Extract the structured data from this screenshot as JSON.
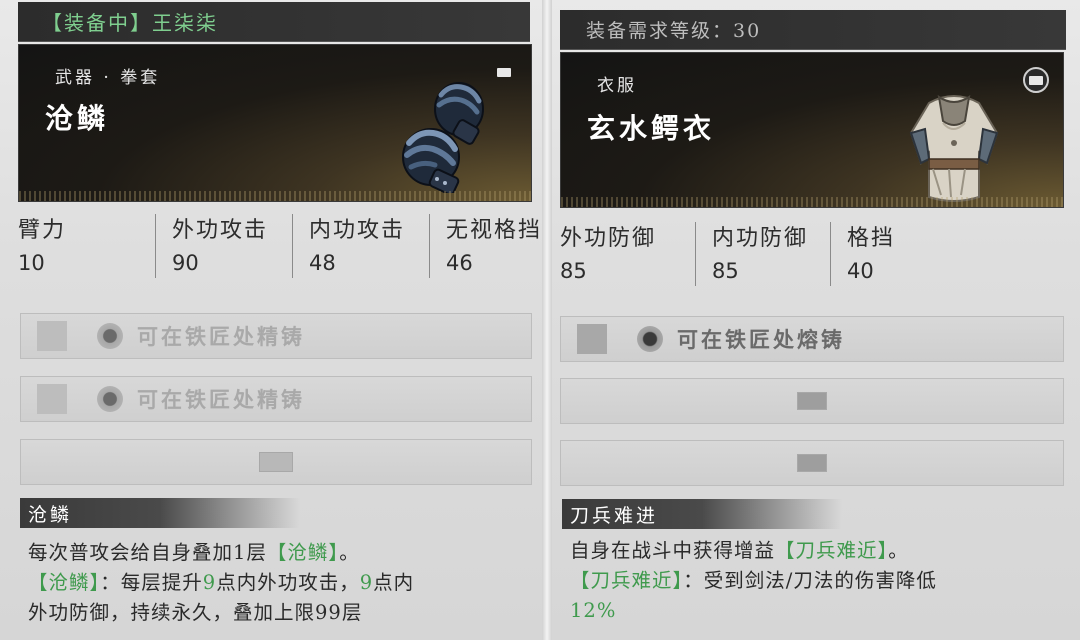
{
  "left": {
    "top_bar": {
      "text": "【装备中】王柒柒"
    },
    "item": {
      "category": "武器 · 拳套",
      "name": "沧鳞",
      "art_icon": "gauntlets-icon",
      "corner_icon": "slot-icon"
    },
    "stats": [
      {
        "label": "臂力",
        "value": "10"
      },
      {
        "label": "外功攻击",
        "value": "90"
      },
      {
        "label": "内功攻击",
        "value": "48"
      },
      {
        "label": "无视格挡",
        "value": "46"
      }
    ],
    "forge_rows": [
      {
        "text": "可在铁匠处精铸"
      },
      {
        "text": "可在铁匠处精铸"
      }
    ],
    "empty_slot_icon": "slot-icon",
    "effect": {
      "title": "沧鳞",
      "line1_a": "每次普攻会给自身叠加1层",
      "line1_hl": "【沧鳞】",
      "line1_b": "。",
      "line2_hl": "【沧鳞】",
      "line2_a": "：每层提升",
      "line2_num1": "9",
      "line2_b": "点内外功攻击，",
      "line2_num2": "9",
      "line2_c": "点内",
      "line3": "外功防御，持续永久，叠加上限99层"
    }
  },
  "right": {
    "top_bar": {
      "text": "装备需求等级：30"
    },
    "item": {
      "category": "衣服",
      "name": "玄水鳄衣",
      "art_icon": "armor-icon",
      "corner_icon": "slot-icon"
    },
    "stats": [
      {
        "label": "外功防御",
        "value": "85"
      },
      {
        "label": "内功防御",
        "value": "85"
      },
      {
        "label": "格挡",
        "value": "40"
      }
    ],
    "forge_rows": [
      {
        "text": "可在铁匠处熔铸"
      }
    ],
    "empty_slot_icon": "slot-icon",
    "effect": {
      "title": "刀兵难进",
      "line1_a": "自身在战斗中获得增益",
      "line1_hl": "【刀兵难近】",
      "line1_b": "。",
      "line2_hl": "【刀兵难近】",
      "line2_a": "：受到剑法/刀法的伤害降低",
      "line3_hl": "12%"
    }
  },
  "colors": {
    "equipped_green": "#7fcf8f",
    "highlight_green": "#3f9a4d",
    "dark_bar": "#2c2c2c"
  }
}
